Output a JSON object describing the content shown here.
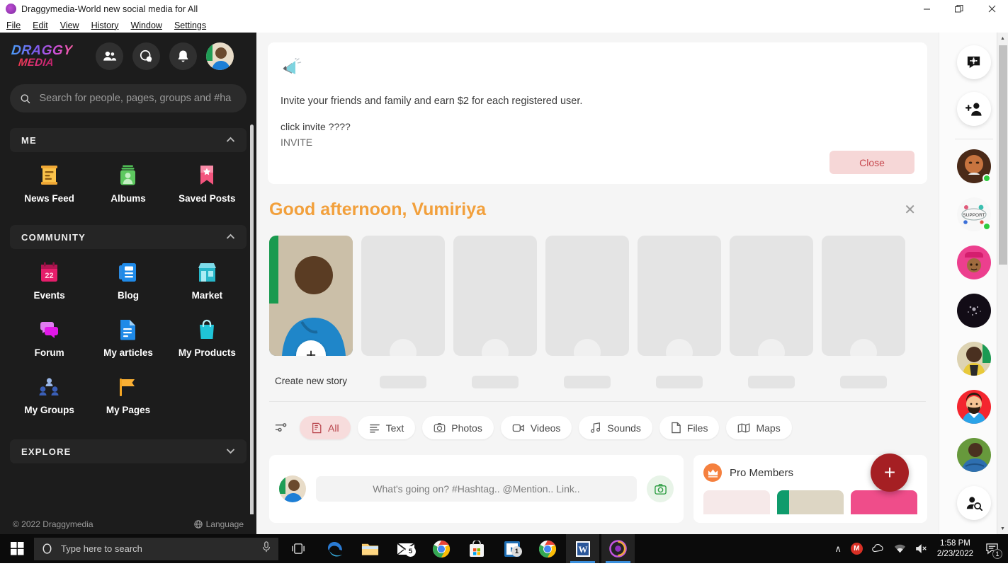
{
  "window": {
    "title": "Draggymedia-World new social media for All",
    "minimize": "—",
    "maximize": "❐",
    "close": "✕"
  },
  "menubar": [
    "File",
    "Edit",
    "View",
    "History",
    "Window",
    "Settings"
  ],
  "sidebar": {
    "logo_line1": "DRAGGY",
    "logo_line2": "MEDIA",
    "top_icons": [
      "friends-icon",
      "messages-icon",
      "notifications-icon",
      "profile-avatar"
    ],
    "search_placeholder": "Search for people, pages, groups and #ha",
    "search_value": "",
    "sections": [
      {
        "title": "ME",
        "chevron": "⌃",
        "expanded": true,
        "items": [
          {
            "label": "News Feed",
            "icon": "news-feed-icon"
          },
          {
            "label": "Albums",
            "icon": "albums-icon"
          },
          {
            "label": "Saved Posts",
            "icon": "saved-posts-icon"
          }
        ]
      },
      {
        "title": "COMMUNITY",
        "chevron": "⌃",
        "expanded": true,
        "items": [
          {
            "label": "Events",
            "icon": "events-calendar-icon"
          },
          {
            "label": "Blog",
            "icon": "blog-icon"
          },
          {
            "label": "Market",
            "icon": "market-store-icon"
          },
          {
            "label": "Forum",
            "icon": "forum-bubbles-icon"
          },
          {
            "label": "My articles",
            "icon": "article-doc-icon"
          },
          {
            "label": "My Products",
            "icon": "shopping-bag-icon"
          },
          {
            "label": "My Groups",
            "icon": "groups-icon"
          },
          {
            "label": "My Pages",
            "icon": "flag-pages-icon"
          }
        ]
      },
      {
        "title": "EXPLORE",
        "chevron": "⌄",
        "expanded": false,
        "items": []
      }
    ],
    "footer_copyright": "© 2022 Draggymedia",
    "footer_language": "Language"
  },
  "banner": {
    "icon": "megaphone-icon",
    "line1": "Invite your friends and family and earn $2 for each registered user.",
    "line2": "click invite  ????",
    "line3": "INVITE",
    "close_label": "Close"
  },
  "greeting": {
    "text": "Good afternoon, Vumiriya",
    "dismiss": "✕"
  },
  "stories": {
    "create_label": "Create new story",
    "create_plus": "+",
    "placeholder_count": 6
  },
  "filters": {
    "tune_icon": "tune-icon",
    "items": [
      {
        "label": "All",
        "icon": "all-icon",
        "active": true
      },
      {
        "label": "Text",
        "icon": "text-icon",
        "active": false
      },
      {
        "label": "Photos",
        "icon": "camera-icon",
        "active": false
      },
      {
        "label": "Videos",
        "icon": "video-icon",
        "active": false
      },
      {
        "label": "Sounds",
        "icon": "music-icon",
        "active": false
      },
      {
        "label": "Files",
        "icon": "file-icon",
        "active": false
      },
      {
        "label": "Maps",
        "icon": "map-icon",
        "active": false
      }
    ]
  },
  "composer": {
    "avatar": "user-avatar",
    "placeholder": "What's going on? #Hashtag.. @Mention.. Link..",
    "camera_icon": "camera-icon"
  },
  "pro_members": {
    "title": "Pro Members",
    "crown_icon": "crown-icon",
    "card_colors": [
      "#f6e9e9",
      "#e3ded2",
      "#ef4d8a"
    ]
  },
  "fab": {
    "label": "+",
    "color": "#a51f23"
  },
  "chat_rail": {
    "buttons": [
      {
        "icon": "chat-settings-icon"
      },
      {
        "icon": "add-friend-icon"
      }
    ],
    "contacts": [
      {
        "avatar": "contact-1",
        "online": true,
        "color": "#6b3a22"
      },
      {
        "avatar": "contact-2",
        "online": true,
        "color": "#f2f2f2"
      },
      {
        "avatar": "contact-3",
        "online": false,
        "color": "#ec3f8e"
      },
      {
        "avatar": "contact-4",
        "online": false,
        "color": "#120c16"
      },
      {
        "avatar": "contact-5",
        "online": false,
        "color": "#d8cfa8"
      },
      {
        "avatar": "contact-6",
        "online": false,
        "color": "#f4262f"
      },
      {
        "avatar": "contact-7",
        "online": false,
        "color": "#5d8d3a"
      }
    ],
    "search_button": {
      "icon": "find-person-icon"
    }
  },
  "colors": {
    "accent_orange": "#f2a03c",
    "accent_red": "#a51f23",
    "sidebar_bg": "#1c1c1c",
    "page_bg": "#f5f5f5",
    "pill_active_bg": "#f7dcdc",
    "pill_active_text": "#b8444b"
  },
  "taskbar": {
    "search_placeholder": "Type here to search",
    "apps": [
      {
        "name": "task-view-icon"
      },
      {
        "name": "edge-icon"
      },
      {
        "name": "file-explorer-icon"
      },
      {
        "name": "mail-icon",
        "badge": "5"
      },
      {
        "name": "chrome-icon"
      },
      {
        "name": "store-icon"
      },
      {
        "name": "media-player-icon"
      },
      {
        "name": "chrome-2-icon"
      },
      {
        "name": "word-icon"
      },
      {
        "name": "draggy-icon"
      }
    ],
    "tray": {
      "chevron": "∧",
      "mail_badge": "M",
      "time": "1:58 PM",
      "date": "2/23/2022",
      "notification_count": "1"
    }
  }
}
